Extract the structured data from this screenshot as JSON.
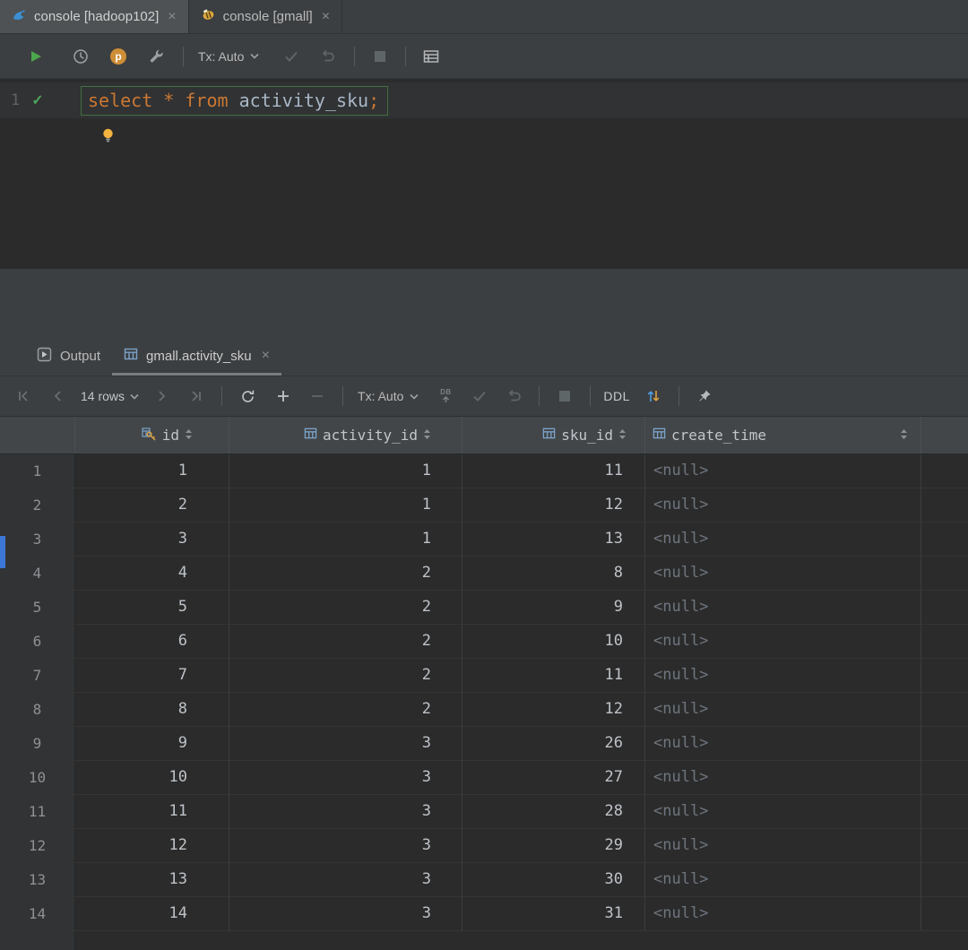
{
  "colors": {
    "run_green": "#4CA64C",
    "keyword_orange": "#CC7832",
    "identifier_gray": "#A9B7C6",
    "key_gold": "#D9A343",
    "table_icon_blue": "#7BA3C9",
    "stripe_blue": "#3C77D8",
    "bulb_yellow": "#F2B33F",
    "null_gray": "#6E757E",
    "editor_bg": "#2B2B2B",
    "panel_bg": "#3C3F41"
  },
  "icons": {
    "close": "×",
    "statement_check": "✓",
    "profiler_letter": "p"
  },
  "editor_tabs": [
    {
      "label": "console [hadoop102]"
    },
    {
      "label": "console [gmall]"
    }
  ],
  "editor_toolbar": {
    "tx": "Tx: Auto"
  },
  "editor": {
    "line_number": "1",
    "code": {
      "kw_select": "select",
      "star": "*",
      "kw_from": "from",
      "table": "activity_sku",
      "semicolon": ";"
    }
  },
  "output": {
    "tabs": [
      {
        "label": "Output"
      },
      {
        "label": "gmall.activity_sku"
      }
    ],
    "toolbar": {
      "rows": "14 rows",
      "tx": "Tx: Auto",
      "db": "DB",
      "ddl": "DDL"
    }
  },
  "grid": {
    "columns": [
      {
        "name": "id"
      },
      {
        "name": "activity_id"
      },
      {
        "name": "sku_id"
      },
      {
        "name": "create_time"
      }
    ],
    "rows": [
      {
        "n": "1",
        "id": "1",
        "activity_id": "1",
        "sku_id": "11",
        "create_time": "<null>"
      },
      {
        "n": "2",
        "id": "2",
        "activity_id": "1",
        "sku_id": "12",
        "create_time": "<null>"
      },
      {
        "n": "3",
        "id": "3",
        "activity_id": "1",
        "sku_id": "13",
        "create_time": "<null>"
      },
      {
        "n": "4",
        "id": "4",
        "activity_id": "2",
        "sku_id": "8",
        "create_time": "<null>"
      },
      {
        "n": "5",
        "id": "5",
        "activity_id": "2",
        "sku_id": "9",
        "create_time": "<null>"
      },
      {
        "n": "6",
        "id": "6",
        "activity_id": "2",
        "sku_id": "10",
        "create_time": "<null>"
      },
      {
        "n": "7",
        "id": "7",
        "activity_id": "2",
        "sku_id": "11",
        "create_time": "<null>"
      },
      {
        "n": "8",
        "id": "8",
        "activity_id": "2",
        "sku_id": "12",
        "create_time": "<null>"
      },
      {
        "n": "9",
        "id": "9",
        "activity_id": "3",
        "sku_id": "26",
        "create_time": "<null>"
      },
      {
        "n": "10",
        "id": "10",
        "activity_id": "3",
        "sku_id": "27",
        "create_time": "<null>"
      },
      {
        "n": "11",
        "id": "11",
        "activity_id": "3",
        "sku_id": "28",
        "create_time": "<null>"
      },
      {
        "n": "12",
        "id": "12",
        "activity_id": "3",
        "sku_id": "29",
        "create_time": "<null>"
      },
      {
        "n": "13",
        "id": "13",
        "activity_id": "3",
        "sku_id": "30",
        "create_time": "<null>"
      },
      {
        "n": "14",
        "id": "14",
        "activity_id": "3",
        "sku_id": "31",
        "create_time": "<null>"
      }
    ]
  }
}
